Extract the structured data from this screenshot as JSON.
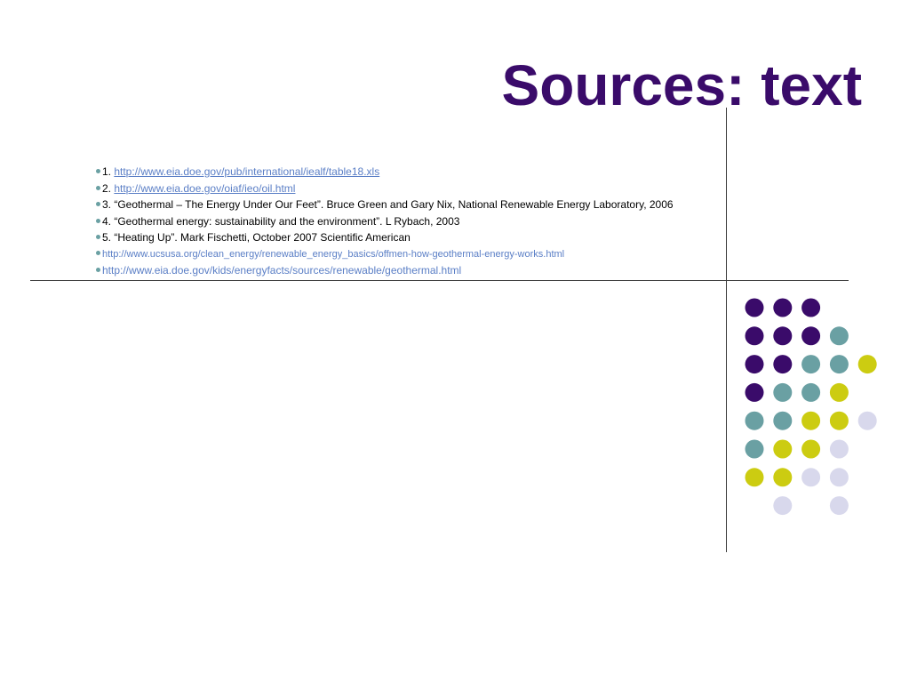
{
  "slide": {
    "title": "Sources: text",
    "sources": [
      {
        "prefix": "1. ",
        "link": "http://www.eia.doe.gov/pub/international/iealf/table18.xls",
        "text": ""
      },
      {
        "prefix": "2. ",
        "link": "http://www.eia.doe.gov/oiaf/ieo/oil.html",
        "text": ""
      },
      {
        "prefix": "",
        "link": "",
        "text": "3. “Geothermal – The Energy Under Our Feet”. Bruce Green and Gary Nix, National Renewable Energy Laboratory, 2006"
      },
      {
        "prefix": "",
        "link": "",
        "text": "4. “Geothermal energy: sustainability and the environment”. L Rybach, 2003"
      },
      {
        "prefix": "",
        "link": "",
        "text": "5. “Heating Up”. Mark Fischetti, October 2007 Scientific American"
      },
      {
        "prefix": "",
        "link": "http://www.ucsusa.org/clean_energy/renewable_energy_basics/offmen-how-geothermal-energy-works.html",
        "text": ""
      },
      {
        "prefix": "",
        "link": "http://www.eia.doe.gov/kids/energyfacts/sources/renewable/geothermal.html",
        "text": ""
      }
    ]
  },
  "colors": {
    "title": "#3a0b6a",
    "purple": "#3a0b6a",
    "teal": "#6aa0a3",
    "yellow": "#cccc11",
    "lavender": "#d8d8ec",
    "link": "#5b7fc6",
    "rule": "#3a3a3a"
  },
  "decoration": {
    "dot_grid": [
      [
        "purple",
        "purple",
        "purple",
        "",
        ""
      ],
      [
        "purple",
        "purple",
        "purple",
        "teal",
        ""
      ],
      [
        "purple",
        "purple",
        "teal",
        "teal",
        "yellow"
      ],
      [
        "purple",
        "teal",
        "teal",
        "yellow",
        ""
      ],
      [
        "teal",
        "teal",
        "yellow",
        "yellow",
        "lavender"
      ],
      [
        "teal",
        "yellow",
        "yellow",
        "lavender",
        ""
      ],
      [
        "yellow",
        "yellow",
        "lavender",
        "lavender",
        ""
      ],
      [
        "",
        "lavender",
        "",
        "lavender",
        ""
      ]
    ]
  }
}
